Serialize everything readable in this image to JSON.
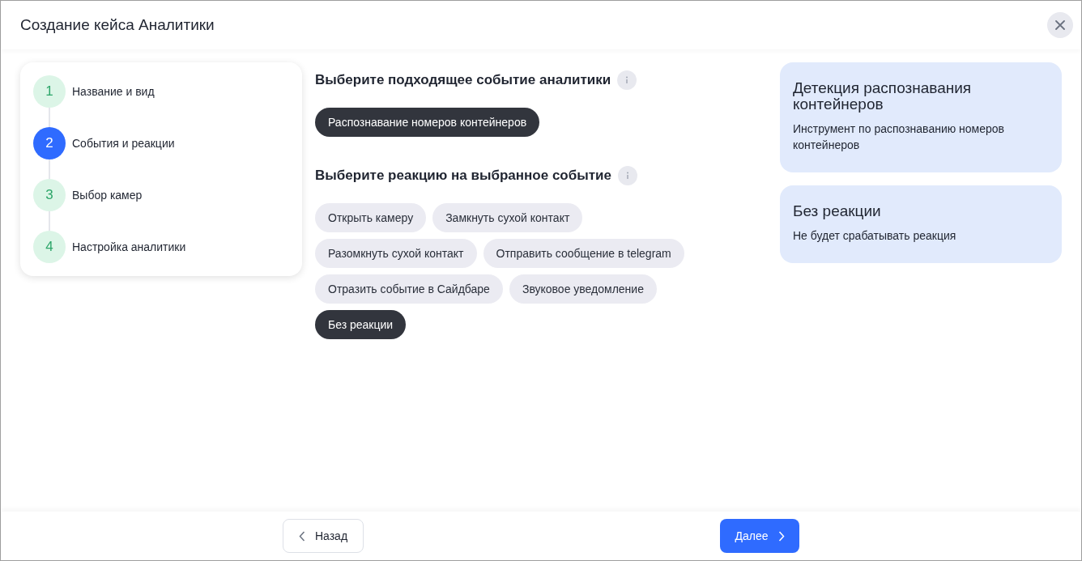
{
  "window": {
    "title": "Создание кейса Аналитики"
  },
  "steps": [
    {
      "number": "1",
      "label": "Название и вид",
      "selected": false
    },
    {
      "number": "2",
      "label": "События и реакции",
      "selected": true
    },
    {
      "number": "3",
      "label": "Выбор камер",
      "selected": false
    },
    {
      "number": "4",
      "label": "Настройка аналитики",
      "selected": false
    }
  ],
  "sections": [
    {
      "heading": "Выберите подходящее событие аналитики",
      "options": [
        {
          "label": "Распознавание номеров контейнеров",
          "selected": true
        }
      ]
    },
    {
      "heading": "Выберите реакцию на выбранное событие",
      "options": [
        {
          "label": "Открыть камеру",
          "selected": false
        },
        {
          "label": "Замкнуть сухой контакт",
          "selected": false
        },
        {
          "label": "Разомкнуть сухой контакт",
          "selected": false
        },
        {
          "label": "Отправить сообщение в telegram",
          "selected": false
        },
        {
          "label": "Отразить событие в Сайдбаре",
          "selected": false
        },
        {
          "label": "Звуковое уведомление",
          "selected": false
        },
        {
          "label": "Без реакции",
          "selected": true
        }
      ]
    }
  ],
  "info_cards": [
    {
      "title": "Детекция распознавания контейнеров",
      "description": "Инструмент по распознаванию номеров контейнеров"
    },
    {
      "title": "Без реакции",
      "description": "Не будет срабатывать реакция"
    }
  ],
  "footer": {
    "back": "Назад",
    "next": "Далее"
  }
}
